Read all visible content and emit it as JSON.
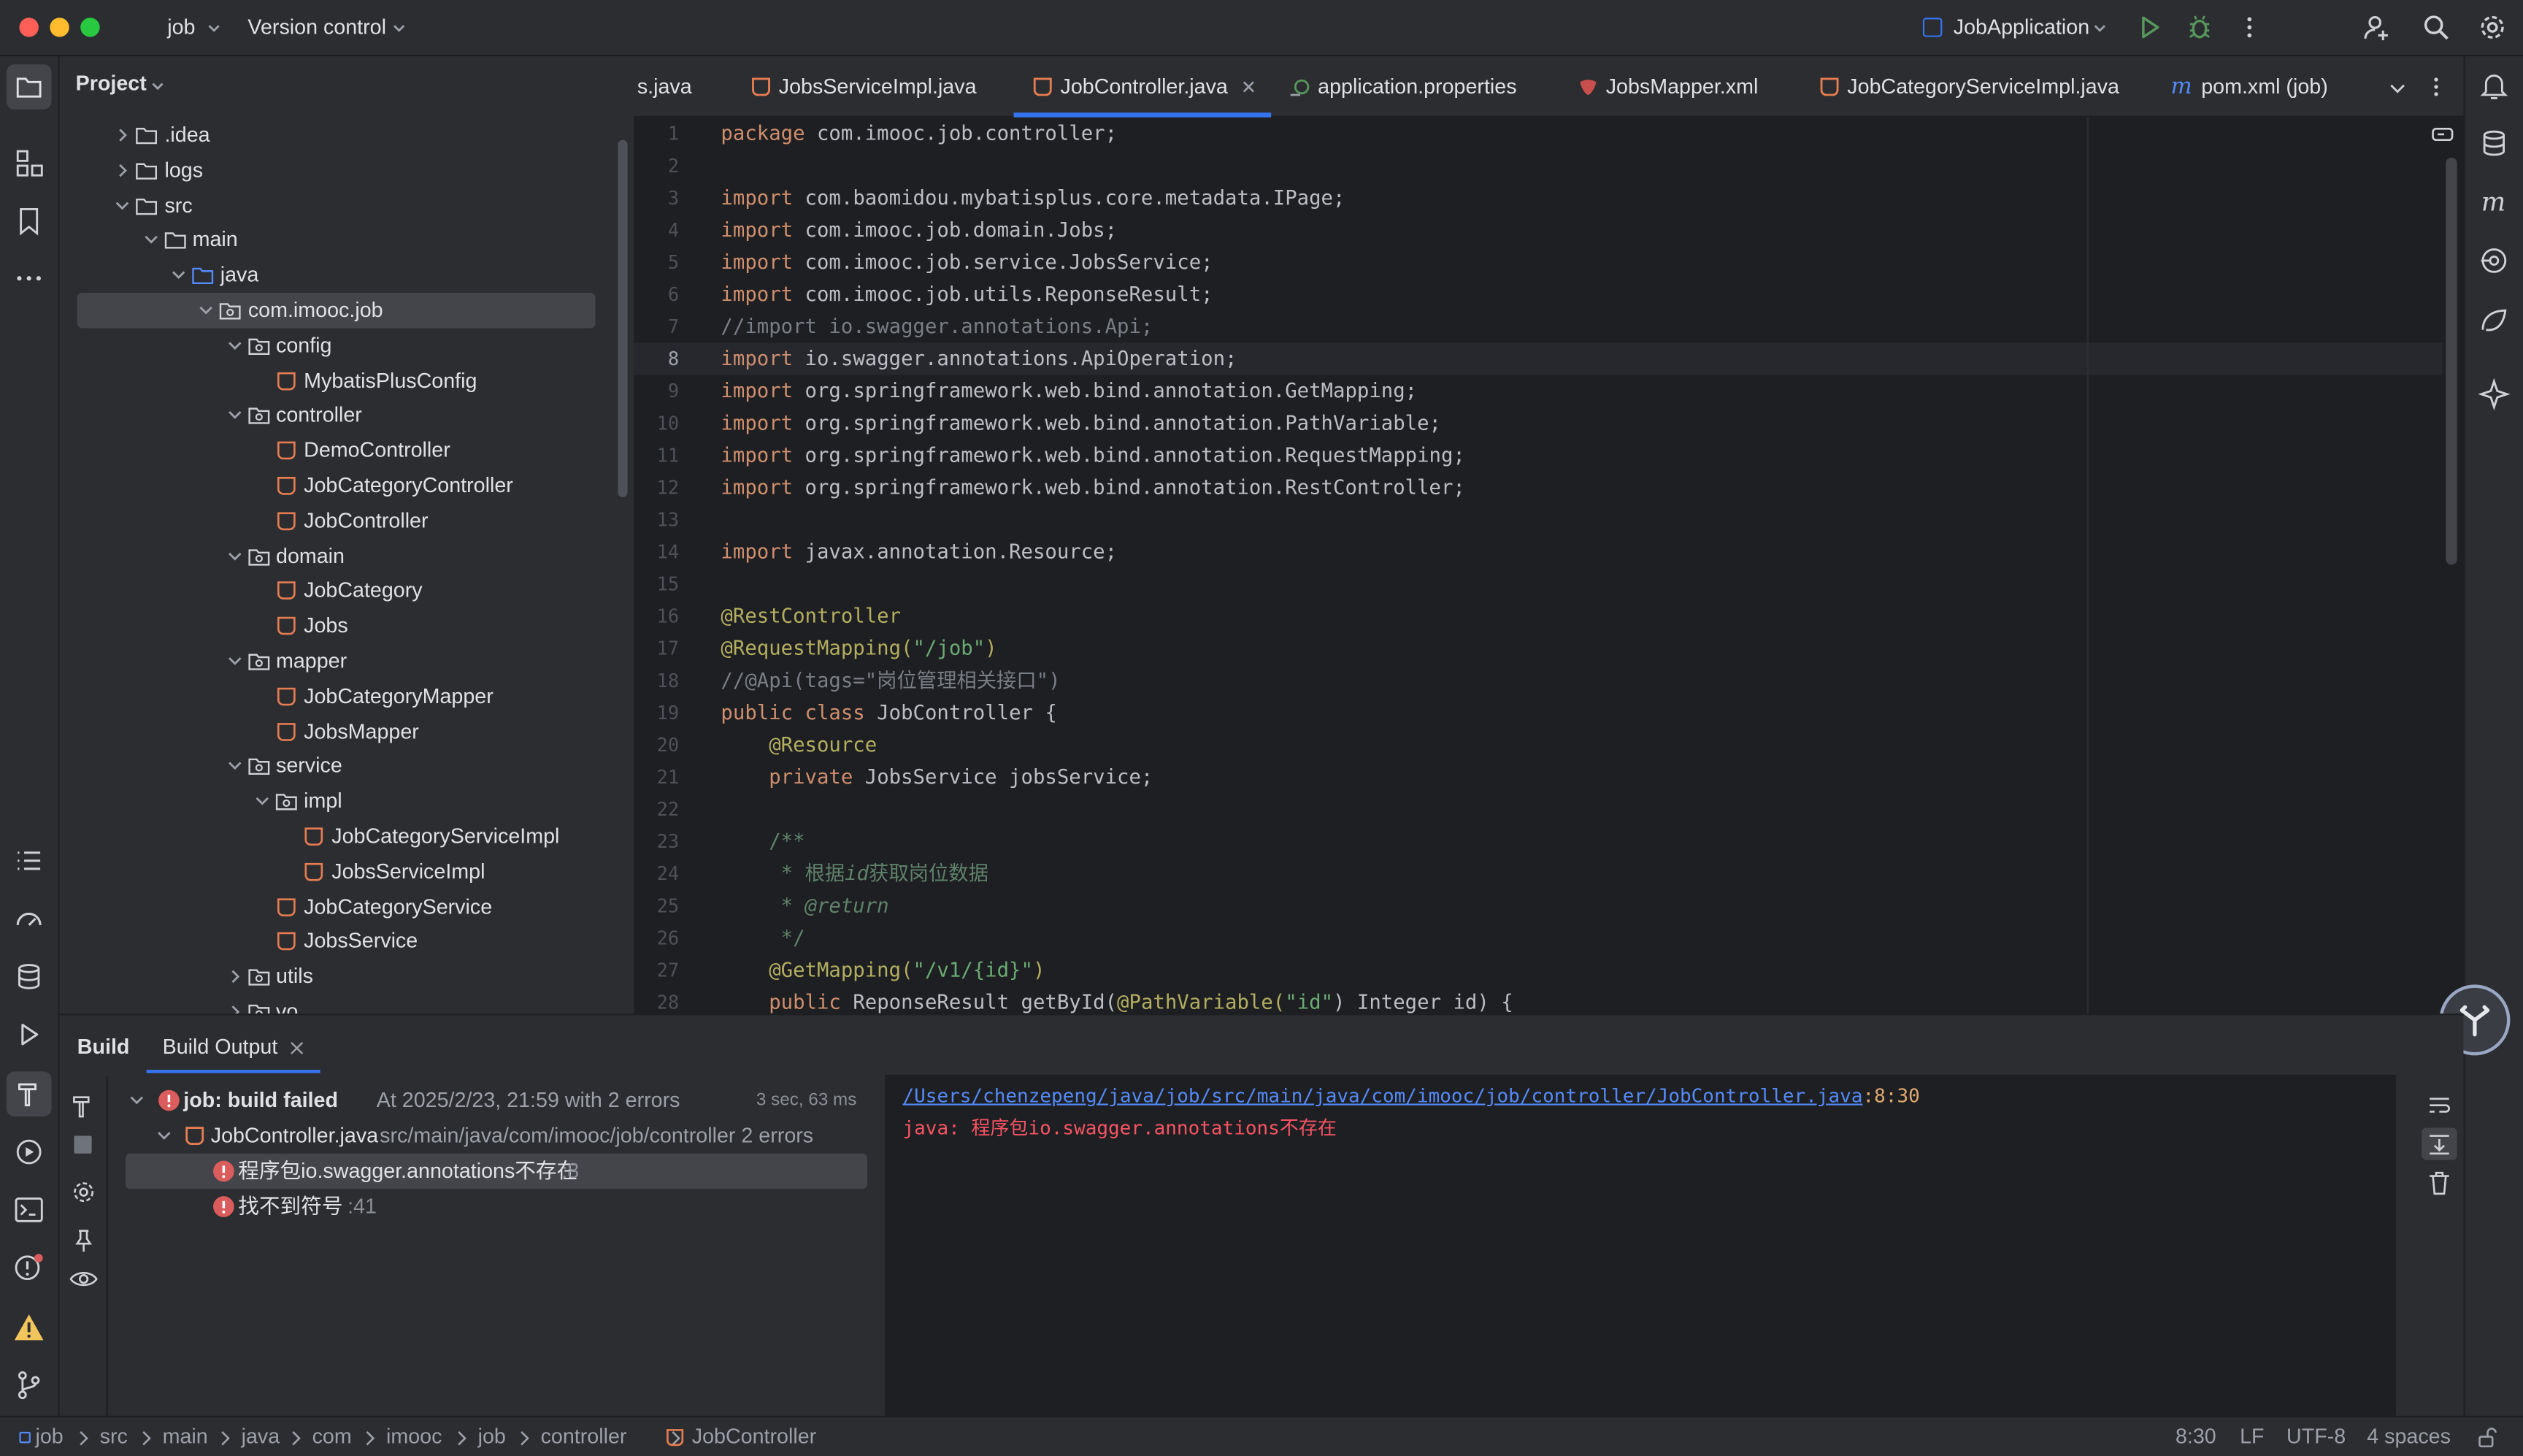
{
  "titlebar": {
    "project": "job",
    "vcs": "Version control",
    "run_config": "JobApplication"
  },
  "project_panel": {
    "title": "Project",
    "tree": [
      {
        "label": ".idea",
        "icon": "folder-icon",
        "chev": "right"
      },
      {
        "label": "logs",
        "icon": "folder-icon",
        "chev": "right"
      },
      {
        "label": "src",
        "icon": "folder-icon",
        "chev": "down"
      },
      {
        "label": "main",
        "icon": "folder-icon",
        "chev": "down"
      },
      {
        "label": "java",
        "icon": "source-folder-icon",
        "chev": "down"
      },
      {
        "label": "com.imooc.job",
        "icon": "package-icon",
        "chev": "down",
        "selected": true
      },
      {
        "label": "config",
        "icon": "package-icon",
        "chev": "down"
      },
      {
        "label": "MybatisPlusConfig",
        "icon": "java-class-icon"
      },
      {
        "label": "controller",
        "icon": "package-icon",
        "chev": "down"
      },
      {
        "label": "DemoController",
        "icon": "java-class-icon"
      },
      {
        "label": "JobCategoryController",
        "icon": "java-class-icon"
      },
      {
        "label": "JobController",
        "icon": "java-class-icon"
      },
      {
        "label": "domain",
        "icon": "package-icon",
        "chev": "down"
      },
      {
        "label": "JobCategory",
        "icon": "java-class-icon"
      },
      {
        "label": "Jobs",
        "icon": "java-class-icon"
      },
      {
        "label": "mapper",
        "icon": "package-icon",
        "chev": "down"
      },
      {
        "label": "JobCategoryMapper",
        "icon": "java-class-icon"
      },
      {
        "label": "JobsMapper",
        "icon": "java-class-icon"
      },
      {
        "label": "service",
        "icon": "package-icon",
        "chev": "down"
      },
      {
        "label": "impl",
        "icon": "package-icon",
        "chev": "down"
      },
      {
        "label": "JobCategoryServiceImpl",
        "icon": "java-class-icon"
      },
      {
        "label": "JobsServiceImpl",
        "icon": "java-class-icon"
      },
      {
        "label": "JobCategoryService",
        "icon": "java-class-icon"
      },
      {
        "label": "JobsService",
        "icon": "java-class-icon"
      },
      {
        "label": "utils",
        "icon": "package-icon",
        "chev": "right"
      },
      {
        "label": "vo",
        "icon": "package-icon",
        "chev": "right"
      }
    ]
  },
  "tabs": [
    {
      "label": "s.java",
      "icon": ""
    },
    {
      "label": "JobsServiceImpl.java",
      "icon": "java-class-icon"
    },
    {
      "label": "JobController.java",
      "icon": "java-class-icon",
      "active": true
    },
    {
      "label": "application.properties",
      "icon": "properties-icon"
    },
    {
      "label": "JobsMapper.xml",
      "icon": "xml-icon"
    },
    {
      "label": "JobCategoryServiceImpl.java",
      "icon": "java-class-icon"
    },
    {
      "label": "pom.xml (job)",
      "icon": "maven-icon"
    }
  ],
  "code_lines": [
    "1",
    "2",
    "3",
    "4",
    "5",
    "6",
    "7",
    "8",
    "9",
    "10",
    "11",
    "12",
    "13",
    "14",
    "15",
    "16",
    "17",
    "18",
    "19",
    "20",
    "21",
    "22",
    "23",
    "24",
    "25",
    "26",
    "27",
    "28"
  ],
  "code": {
    "l1a": "package",
    "l1b": " com.imooc.job.controller;",
    "l3a": "import",
    "l3b": " com.baomidou.mybatisplus.core.metadata.IPage;",
    "l4a": "import",
    "l4b": " com.imooc.job.domain.Jobs;",
    "l5a": "import",
    "l5b": " com.imooc.job.service.JobsService;",
    "l6a": "import",
    "l6b": " com.imooc.job.utils.ReponseResult;",
    "l7": "//import io.swagger.annotations.Api;",
    "l8a": "import",
    "l8b": " io.swagger.annotations.ApiOperation;",
    "l9a": "import",
    "l9b": " org.springframework.web.bind.annotation.GetMapping;",
    "l10a": "import",
    "l10b": " org.springframework.web.bind.annotation.PathVariable;",
    "l11a": "import",
    "l11b": " org.springframework.web.bind.annotation.RequestMapping;",
    "l12a": "import",
    "l12b": " org.springframework.web.bind.annotation.RestController;",
    "l14a": "import",
    "l14b": " javax.annotation.Resource;",
    "l16": "@RestController",
    "l17a": "@RequestMapping(",
    "l17b": "\"/job\"",
    "l17c": ")",
    "l18": "//@Api(tags=\"岗位管理相关接口\")",
    "l19a": "public class",
    "l19b": " JobController {",
    "l20": "    @Resource",
    "l21a": "    private",
    "l21b": " JobsService jobsService;",
    "l23": "    /**",
    "l24a": "     * 根据",
    "l24b": "id",
    "l24c": "获取岗位数据",
    "l25a": "     * ",
    "l25b": "@return",
    "l26": "     */",
    "l27a": "    @GetMapping(",
    "l27b": "\"/v1/{id}\"",
    "l27c": ")",
    "l28a": "    public",
    "l28b": " ReponseResult getById(",
    "l28c": "@PathVariable(",
    "l28d": "\"id\"",
    "l28e": ") Integer id) {"
  },
  "build": {
    "tab_build": "Build",
    "tab_output": "Build Output",
    "root_bold": "job: build failed",
    "root_rest": " At 2025/2/23, 21:59 with 2 errors",
    "root_time": "3 sec, 63 ms",
    "file_name": "JobController.java",
    "file_path": " src/main/java/com/imooc/job/controller 2 errors",
    "err1": "程序包io.swagger.annotations不存在",
    "err1_line": " :8",
    "err2": "找不到符号",
    "err2_line": " :41",
    "out_link": "/Users/chenzepeng/java/job/src/main/java/com/imooc/job/controller/JobController.java",
    "out_pos": ":8:30",
    "out_msg": "java: 程序包io.swagger.annotations不存在"
  },
  "statusbar": {
    "crumbs": [
      "job",
      "src",
      "main",
      "java",
      "com",
      "imooc",
      "job",
      "controller",
      "JobController"
    ],
    "position": "8:30",
    "line_sep": "LF",
    "encoding": "UTF-8",
    "indent": "4 spaces"
  },
  "colors": {
    "accent": "#3574f0",
    "error": "#db5c5c",
    "java_icon": "#e67d52"
  }
}
